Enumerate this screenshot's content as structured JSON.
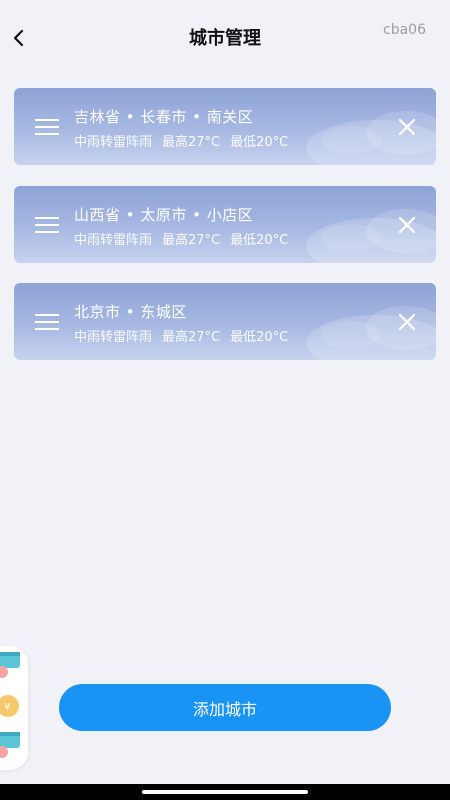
{
  "header": {
    "back_icon": "chevron-left-icon",
    "title": "城市管理",
    "tag": "cba06"
  },
  "cities": [
    {
      "location": "吉林省 • 长春市 • 南关区",
      "weather": "中雨转雷阵雨",
      "high": "最高27°C",
      "low": "最低20°C"
    },
    {
      "location": "山西省 • 太原市 • 小店区",
      "weather": "中雨转雷阵雨",
      "high": "最高27°C",
      "low": "最低20°C"
    },
    {
      "location": "北京市 • 东城区",
      "weather": "中雨转雷阵雨",
      "high": "最高27°C",
      "low": "最低20°C"
    }
  ],
  "add_button_label": "添加城市",
  "colors": {
    "background": "#f0f2f7",
    "card_top": "#8ea3d6",
    "button": "#1a94f4"
  }
}
